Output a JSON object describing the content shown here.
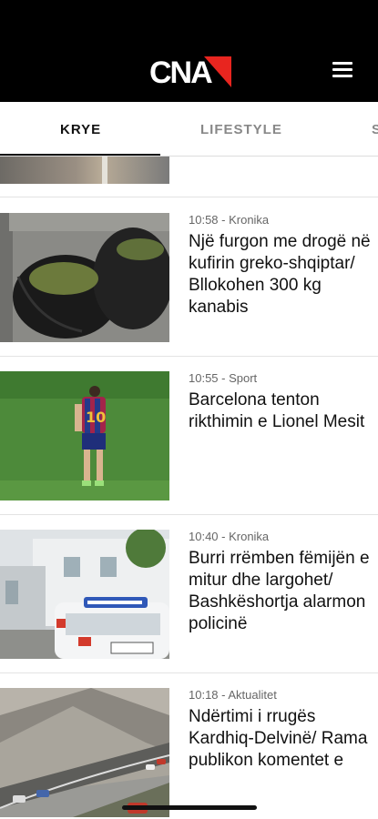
{
  "header": {
    "logo_text": "CNA",
    "colors": {
      "background": "#000000",
      "logo_mark": "#e8251f"
    },
    "menu_icon": "hamburger-icon"
  },
  "tabs": [
    {
      "label": "KRYE",
      "active": true
    },
    {
      "label": "LIFESTYLE",
      "active": false
    },
    {
      "label": "S",
      "active": false
    }
  ],
  "articles": [
    {
      "time": "10:58",
      "category": "Kronika",
      "meta": "10:58 - Kronika",
      "title": "Një furgon me drogë në kufirin greko-shqiptar/ Bllokohen 300 kg kanabis"
    },
    {
      "time": "10:55",
      "category": "Sport",
      "meta": "10:55 - Sport",
      "title": "Barcelona tenton rikthimin e Lionel Mesit"
    },
    {
      "time": "10:40",
      "category": "Kronika",
      "meta": "10:40 - Kronika",
      "title": "Burri rrëmben fëmijën e mitur dhe largohet/ Bashkëshortja alarmon policinë"
    },
    {
      "time": "10:18",
      "category": "Aktualitet",
      "meta": "10:18 - Aktualitet",
      "title": "Ndërtimi i rrugës Kardhiq-Delvinë/ Rama publikon komentet e"
    }
  ]
}
